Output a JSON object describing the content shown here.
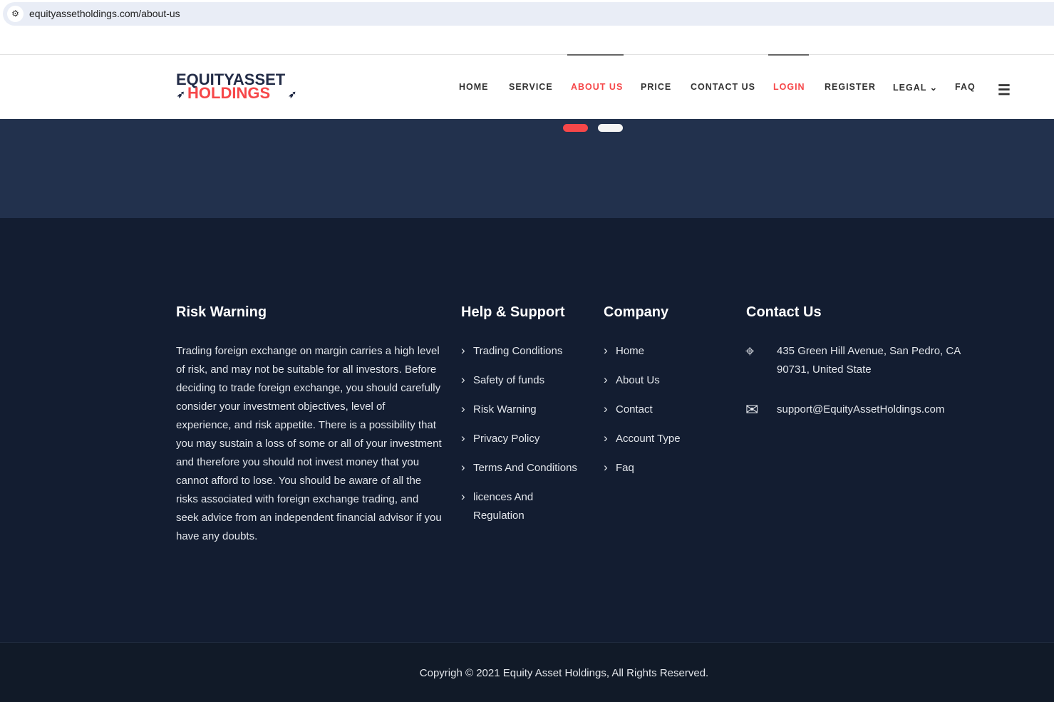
{
  "browser": {
    "url": "equityassetholdings.com/about-us"
  },
  "logo": {
    "line1": "EQUITYASSET",
    "line2": "HOLDINGS"
  },
  "nav": [
    {
      "label": "HOME"
    },
    {
      "label": "SERVICE"
    },
    {
      "label": "ABOUT US"
    },
    {
      "label": "PRICE"
    },
    {
      "label": "CONTACT US"
    },
    {
      "label": "LOGIN"
    },
    {
      "label": "REGISTER"
    },
    {
      "label": "LEGAL ⌄"
    },
    {
      "label": "FAQ"
    }
  ],
  "colors": {
    "accent": "#f64749",
    "band": "#22314d",
    "footer": "#131d31"
  },
  "footer": {
    "risk": {
      "title": "Risk Warning",
      "text": "Trading foreign exchange on margin carries a high level of risk, and may not be suitable for all investors. Before deciding to trade foreign exchange, you should carefully consider your investment objectives, level of experience, and risk appetite. There is a possibility that you may sustain a loss of some or all of your investment and therefore you should not invest money that you cannot afford to lose. You should be aware of all the risks associated with foreign exchange trading, and seek advice from an independent financial advisor if you have any doubts."
    },
    "help": {
      "title": "Help & Support",
      "items": [
        "Trading Conditions",
        "Safety of funds",
        "Risk Warning",
        "Privacy Policy",
        "Terms And Conditions",
        "licences And Regulation"
      ]
    },
    "company": {
      "title": "Company",
      "items": [
        "Home",
        "About Us",
        "Contact",
        "Account Type",
        "Faq"
      ]
    },
    "contact": {
      "title": "Contact Us",
      "address": "435 Green Hill Avenue, San Pedro, CA 90731, United State",
      "email": "support@EquityAssetHoldings.com"
    }
  },
  "copyright": "Copyrigh © 2021 Equity Asset Holdings, All Rights Reserved."
}
